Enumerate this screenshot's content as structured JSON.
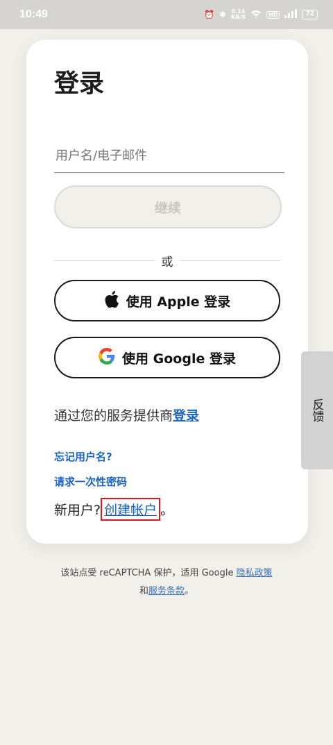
{
  "status_bar": {
    "time": "10:49",
    "speed_value": "0.14",
    "speed_unit": "KB/S",
    "hd": "HD",
    "signal": "5G",
    "battery": "72"
  },
  "login": {
    "title": "登录",
    "username_placeholder": "用户名/电子邮件",
    "continue_label": "继续",
    "or_label": "或",
    "apple_label": "使用 Apple 登录",
    "google_label": "使用 Google 登录",
    "provider_text": "通过您的服务提供商",
    "provider_link": "登录",
    "forgot_username": "忘记用户名?",
    "request_otp": "请求一次性密码",
    "new_user_text": "新用户?",
    "create_account": "创建帐户",
    "period": "。"
  },
  "feedback": {
    "label": "反馈"
  },
  "footer": {
    "line1_text": "该站点受 reCAPTCHA 保护，适用 Google ",
    "privacy_link": "隐私政策",
    "and_text": "和",
    "terms_link": "服务条款",
    "end": "。"
  },
  "colors": {
    "background": "#f2f0eb",
    "link": "#1b63c6",
    "highlight_border": "#e0161b"
  }
}
